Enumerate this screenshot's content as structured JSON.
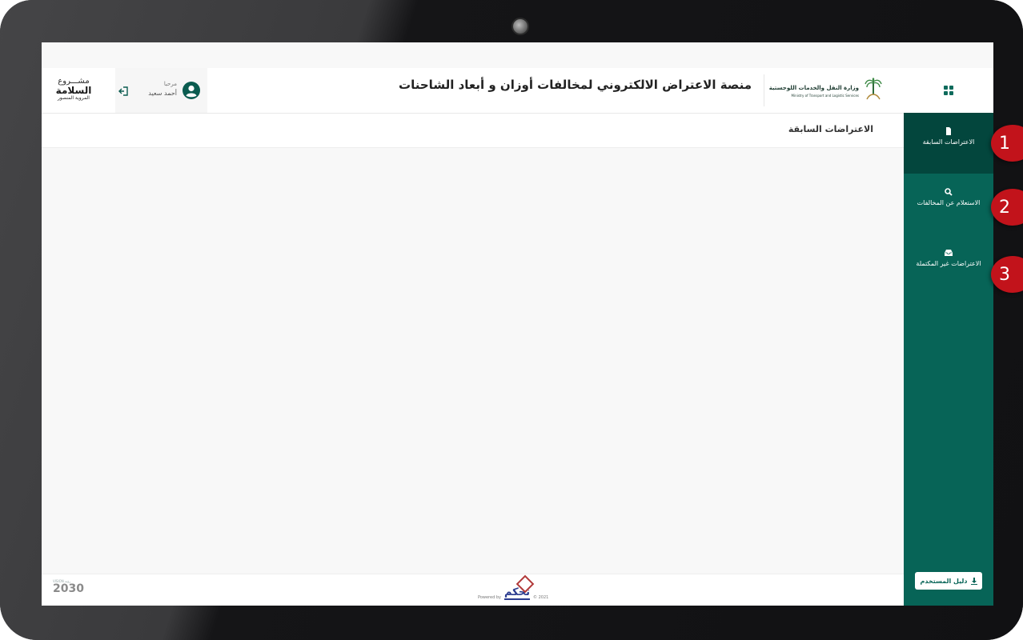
{
  "app": {
    "title": "منصة الاعتراض الالكتروني لمخالفات أوزان و أبعاد الشاحنات",
    "ministry_name_ar": "وزارة النقل والخدمات اللوجستية",
    "ministry_name_en": "Ministry of Transport and Logistic Services",
    "safety_logo": {
      "line1": "مشـــروع",
      "line2": "السلامة",
      "line3": "المروية المنصور"
    }
  },
  "user": {
    "greeting": "مرحبا",
    "name": "أحمد سعيد"
  },
  "page": {
    "heading": "الاعتراضات السابقة"
  },
  "sidebar": {
    "items": [
      {
        "label": "الاعتراضات السابقة",
        "icon": "file-icon",
        "active": true
      },
      {
        "label": "الاستعلام عن المخالفات",
        "icon": "search-icon",
        "active": false
      },
      {
        "label": "الاعتراضات غير المكتملة",
        "icon": "inbox-icon",
        "active": false
      }
    ],
    "guide_label": "دليل المستخدم"
  },
  "footer": {
    "powered_by": "Powered by",
    "brand": "تحكم",
    "copyright": "© 2021",
    "vision_small": "VISION رؤية",
    "vision_year": "2030"
  },
  "markers": [
    "1",
    "2",
    "3"
  ],
  "colors": {
    "sidebar": "#076457",
    "sidebar_active": "#03463d",
    "marker": "#c2131b"
  }
}
